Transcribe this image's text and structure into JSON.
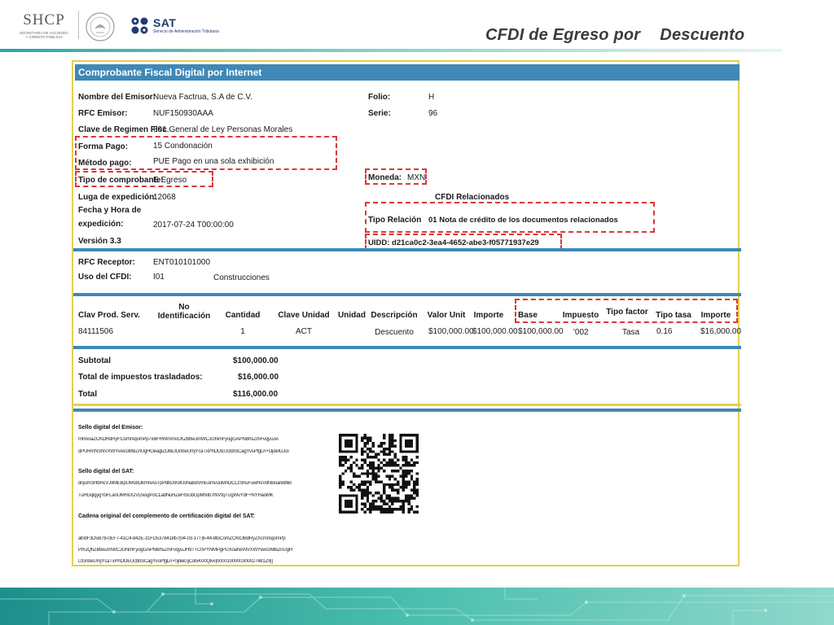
{
  "header": {
    "shcp_word": "SHCP",
    "shcp_sub_1": "SECRETARÍA DE HACIENDA",
    "shcp_sub_2": "Y CRÉDITO PÚBLICO",
    "sat_word": "SAT",
    "sat_sub": "Servicio de Administración Tributaria",
    "title_a": "CFDI de Egreso por",
    "title_b": "Descuento"
  },
  "document": {
    "heading": "Comprobante Fiscal Digital por Internet",
    "emisor": {
      "nombre_label": "Nombre del Emisor:",
      "nombre": "Nueva Factrua, S.A de C.V.",
      "rfc_label": "RFC Emisor:",
      "rfc": "NUF150930AAA",
      "regimen_label": "Clave de Regimen Fisc",
      "regimen": "601,General de Ley Personas Morales",
      "forma_label": "Forma Pago:",
      "forma": "15 Condonación",
      "metodo_label": "Método pago:",
      "metodo": "PUE Pago en una sola exhibición",
      "tipo_label": "Tipo de comprobante:",
      "tipo": "E Egreso",
      "lugar_label": "Luga de expedición:",
      "lugar": "12068",
      "fecha_label_1": "Fecha y Hora de",
      "fecha_label_2": "expedición:",
      "fecha": "2017-07-24 T00:00:00",
      "version": "Versión 3.3"
    },
    "right": {
      "folio_label": "Folio:",
      "folio": "H",
      "serie_label": "Serie:",
      "serie": "96",
      "moneda_label": "Moneda:",
      "moneda": "MXN",
      "cfdi_rel": "CFDI Relacionados",
      "tipo_rel_label": "Tipo Relación",
      "tipo_rel": "01 Nota de crédito de los documentos relacionados",
      "uuid": "UIDD: d21ca0c2-3ea4-4652-abe3-f05771937e29"
    },
    "receptor": {
      "rfc_label": "RFC Receptor:",
      "rfc": "ENT010101000",
      "uso_label": "Uso del CFDI:",
      "uso_code": "I01",
      "uso_desc": "Construcciones"
    },
    "concepts": {
      "headers": {
        "clave_prod": "Clav Prod. Serv.",
        "no_ident_1": "No",
        "no_ident_2": "Identificación",
        "cantidad": "Cantidad",
        "clave_unidad": "Clave Unidad",
        "unidad": "Unidad",
        "descripcion": "Descripción",
        "valor_unit": "Valor Unit",
        "importe": "Importe",
        "base": "Base",
        "impuesto": "Impuesto",
        "tipo_factor": "Tipo factor",
        "tipo_tasa": "Tipo tasa",
        "importe_imp": "Importe"
      },
      "row": {
        "clave_prod": "84111506",
        "cantidad": "1",
        "clave_unidad": "ACT",
        "descripcion": "Descuento",
        "valor_unit": "$100,000.00",
        "importe": "$100,000.00",
        "base": "$100,000.00",
        "impuesto": "'002",
        "tipo_factor": "Tasa",
        "tipo_tasa": "0.16",
        "importe_imp": "$16,000.00"
      }
    },
    "totals": {
      "subtotal_label": "Subtotal",
      "subtotal": "$100,000.00",
      "impuestos_label": "Total de impuestos trasladados:",
      "impuestos": "$16,000.00",
      "total_label": "Total",
      "total": "$116,000.00"
    },
    "signatures": {
      "sello_emisor_label": "Sello digital del Emisor:",
      "sello_emisor_1": "mRooaZCKDRdRyFCommqomPp7xBFRWmmvCKZ6bwJmWCJGNmFyogGAPNBhsZmFvqyuJvi",
      "sello_emisor_2": "dPURrnNSNVXWYvwcoMBZnUgHOeaglZDbiLtGnbeUmjYcaTxPhtJOEUcbbSCagYvsPfgLn+OjdeIGJoi",
      "sello_sat_label": "Sello digital del SAT:",
      "sello_sat_1": "dnjumSHbHcVJ9MEBpUMsbOkmNAoTpPdllsXK8UvNabdVmEomvuuMnOCLzShuFuwHsVdNBoalv8lfiB",
      "sello_sat_2": "TuHGqlgygYoFLanUMHxX2VDxogPoCLadNuHZeFlSGbGpMNIb7lNVfqTUgWvYdF+NYHaoMK",
      "cadena_label": "Cadena original del complemento de certificación digital del SAT:",
      "cadena_1": "al0dF3D5B78-0EF7-41C4-842E-31FD5378418b7|04-03-17T|6-44-8toComZCKIOBdRyZXcmmqomPp",
      "cadena_2": "PmJQhZBbwJmWCJGNmFyogGAPNBhsZmFvqyuJH9TTC0PYNMPgPUXoaNANVXWYvwcoMBZnUgH",
      "cadena_3": "LtGnbeUmjYcaTxPhtJOEUcbbSCagYvsPfgLn+0jdeiGjCol5K00Qlvv|0000100000300027481Z9||"
    }
  },
  "colors": {
    "band_blue": "#3f88b8",
    "frame_yellow": "#e2cf4f",
    "highlight_red": "#d93838",
    "header_teal": "#2ba7a4",
    "sat_navy": "#1f3b73"
  }
}
